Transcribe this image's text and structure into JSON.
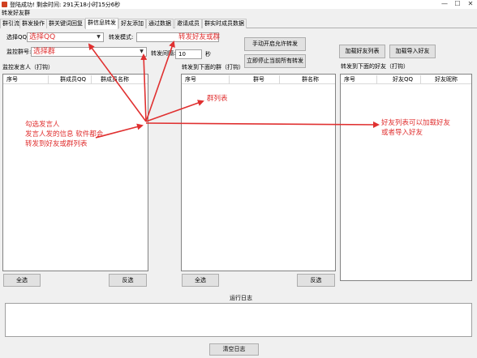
{
  "window": {
    "title": "登陆成功! 剩余时间: 291天18小时15分6秒",
    "subtitle": "转发好友群",
    "controls": [
      "—",
      "☐",
      "✕"
    ]
  },
  "tabs": [
    {
      "label": "群引流",
      "active": false
    },
    {
      "label": "群发操作",
      "active": false
    },
    {
      "label": "群关键词回复",
      "active": false
    },
    {
      "label": "群信息转发",
      "active": true
    },
    {
      "label": "好友添加",
      "active": false
    },
    {
      "label": "通过数据",
      "active": false
    },
    {
      "label": "邀请成员",
      "active": false
    },
    {
      "label": "群实时成员数据",
      "active": false
    }
  ],
  "form": {
    "select_qq_label": "选择QQ:",
    "select_qq_value": "选择QQ",
    "forward_mode_label": "转发模式:",
    "forward_mode_value": "转发好友或群",
    "monitor_group_label": "监控群号:",
    "monitor_group_value": "选择群",
    "forward_interval_label": "转发间隔:",
    "forward_interval_value": "10",
    "interval_unit": "秒",
    "monitor_sender_label": "监控发言人（打钩）",
    "forward_groups_label": "转发到下面的群（打钩）",
    "forward_friends_label": "转发到下面的好友（打钩）"
  },
  "buttons": {
    "manual_start": "手动开启允许转发",
    "stop_all": "立即停止当前所有转发",
    "load_friends": "加载好友列表",
    "import_friends": "加载导入好友",
    "select_all_1": "全选",
    "invert_1": "反选",
    "select_all_2": "全选",
    "invert_2": "反选",
    "clear_log": "清空日志"
  },
  "tables": {
    "members": {
      "columns": [
        "序号",
        "群成员QQ",
        "群成员名称"
      ]
    },
    "groups": {
      "columns": [
        "序号",
        "群号",
        "群名称"
      ]
    },
    "friends": {
      "columns": [
        "序号",
        "好友QQ",
        "好友昵称"
      ]
    }
  },
  "log": {
    "label": "运行日志"
  },
  "annotations": {
    "members_note": [
      "勾选发言人",
      "发言人发的信息 软件都会",
      "转发到好友或群列表"
    ],
    "groups_note": "群列表",
    "friends_note": [
      "好友列表可以加载好友",
      "或者导入好友"
    ]
  },
  "colors": {
    "annotation": "#e03030",
    "window_bg": "#f0f0f0"
  }
}
